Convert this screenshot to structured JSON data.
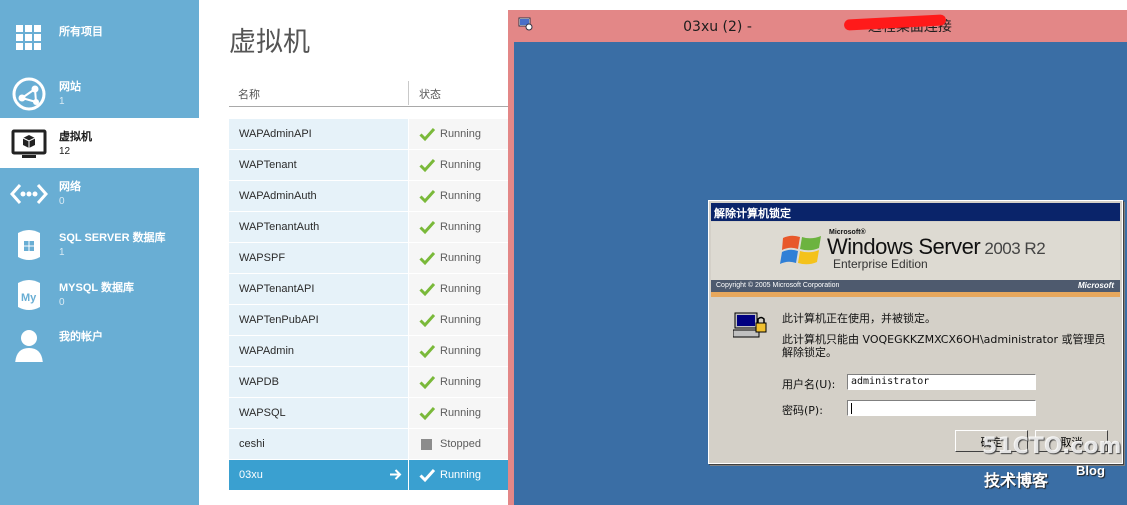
{
  "nav": {
    "items": [
      {
        "label": "所有项目",
        "count": "",
        "icon": "grid-icon"
      },
      {
        "label": "网站",
        "count": "1",
        "icon": "globe-icon"
      },
      {
        "label": "虚拟机",
        "count": "12",
        "icon": "monitor-icon"
      },
      {
        "label": "网络",
        "count": "0",
        "icon": "network-icon"
      },
      {
        "label": "SQL SERVER 数据库",
        "count": "1",
        "icon": "sql-database-icon"
      },
      {
        "label": "MYSQL 数据库",
        "count": "0",
        "icon": "mysql-database-icon"
      },
      {
        "label": "我的帐户",
        "count": "",
        "icon": "user-icon"
      }
    ],
    "selected_index": 2
  },
  "vm_list": {
    "title": "虚拟机",
    "columns": [
      "名称",
      "状态"
    ],
    "rows": [
      {
        "name": "WAPAdminAPI",
        "status": "Running"
      },
      {
        "name": "WAPTenant",
        "status": "Running"
      },
      {
        "name": "WAPAdminAuth",
        "status": "Running"
      },
      {
        "name": "WAPTenantAuth",
        "status": "Running"
      },
      {
        "name": "WAPSPF",
        "status": "Running"
      },
      {
        "name": "WAPTenantAPI",
        "status": "Running"
      },
      {
        "name": "WAPTenPubAPI",
        "status": "Running"
      },
      {
        "name": "WAPAdmin",
        "status": "Running"
      },
      {
        "name": "WAPDB",
        "status": "Running"
      },
      {
        "name": "WAPSQL",
        "status": "Running"
      },
      {
        "name": "ceshi",
        "status": "Stopped"
      },
      {
        "name": "03xu",
        "status": "Running",
        "selected": true
      }
    ]
  },
  "rdp_window": {
    "title_prefix": "03xu (2) - ",
    "title_suffix": "- 远程桌面连接",
    "titlebar_color": "#e38787",
    "desktop_color": "#3a6ea5"
  },
  "lock_dialog": {
    "title": "解除计算机锁定",
    "brand_small": "Microsoft®",
    "product": "Windows Server",
    "product_version": " 2003 R2",
    "edition": "Enterprise Edition",
    "copyright": "Copyright © 2005  Microsoft Corporation",
    "brand": "Microsoft",
    "message_line1": "此计算机正在使用，并被锁定。",
    "message_line2": "此计算机只能由 VOQEGKKZMXCX6OH\\administrator 或管理员",
    "message_line3": "解除锁定。",
    "username_label": "用户名(U):",
    "username_value": "administrator",
    "password_label": "密码(P):",
    "password_value": "",
    "ok_button": "确定",
    "cancel_button": "取消"
  },
  "watermark": {
    "site": "51CTO.com",
    "tagline": "技术博客",
    "blog": "Blog"
  },
  "colors": {
    "nav_bg": "#69aed4",
    "selection_blue": "#3aa0d0",
    "running_green": "#7ab93a",
    "stopped_gray": "#8c8c8c"
  }
}
